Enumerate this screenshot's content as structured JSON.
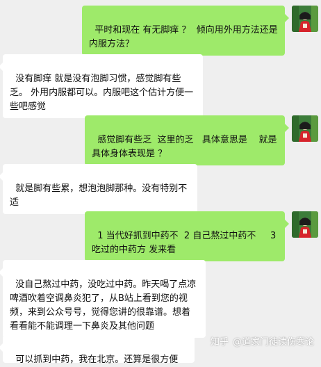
{
  "colors": {
    "background": "#efefef",
    "outgoing_bubble": "#9eea6a",
    "incoming_bubble": "#ffffff",
    "text": "#111111"
  },
  "messages": [
    {
      "side": "right",
      "text": "平时和现在 有无脚痒 ？  倾向用外用方法还是内服方法？"
    },
    {
      "side": "left",
      "text": "没有脚痒 就是没有泡脚习惯，感觉脚有些乏。 外用内服都可以。内服吧这个估计方便一些吧感觉"
    },
    {
      "side": "right",
      "text": "感觉脚有些乏  这里的乏   具体意思是    就是具体身体表现是 ？"
    },
    {
      "side": "left",
      "text": "就是脚有些累，想泡泡脚那种。没有特别不适"
    },
    {
      "side": "right",
      "text": "1 当代好抓到中药不  2 自己熬过中药不     3 吃过的中药方 发来看"
    },
    {
      "side": "left",
      "text": "没自己熬过中药，没吃过中药。昨天喝了点凉啤酒吹着空调鼻炎犯了，从B站上看到您的视频，来到公众号号，觉得您讲的很靠谱。想着看看能不能调理一下鼻炎及其他问题"
    },
    {
      "side": "left",
      "text": "可以抓到中药，我在北京。还算是很方便"
    }
  ],
  "watermark": {
    "site": "知乎",
    "author": "@道家门徒读伤寒论"
  }
}
